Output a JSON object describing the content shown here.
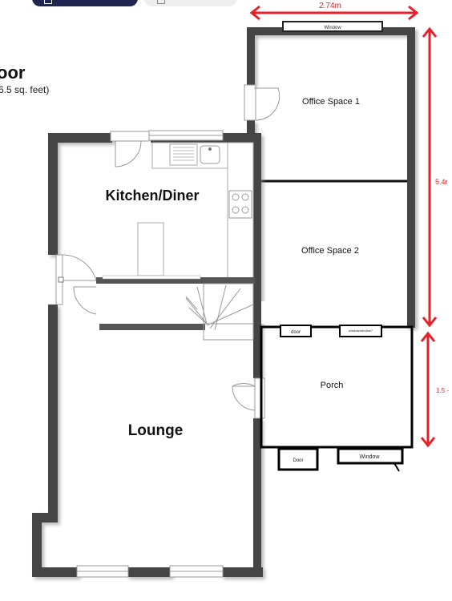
{
  "header": {
    "floor_heading": "oor",
    "area_text": "6.5 sq. feet)"
  },
  "rooms": {
    "office1": "Office Space 1",
    "office2": "Office Space 2",
    "kitchen": "Kitchen/Diner",
    "lounge": "Lounge",
    "porch": "Porch"
  },
  "fixtures": {
    "window_top": "Window",
    "door_left": "door",
    "door_right": "window/window?",
    "door_bottom": "Door",
    "window_bottom": "Window"
  },
  "dimensions": {
    "width": "2.74m",
    "height_office": "5.4r",
    "height_porch": "1.5 -"
  },
  "colors": {
    "wall": "#444444",
    "dimension": "#e8202a",
    "tab_dark": "#1e2550"
  }
}
